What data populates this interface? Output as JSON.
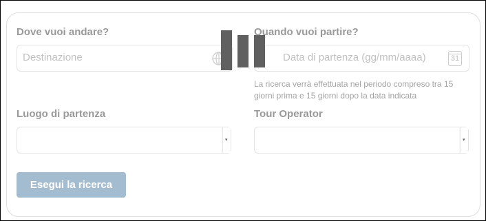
{
  "destination": {
    "label": "Dove vuoi andare?",
    "placeholder": "Destinazione",
    "icon": "globe-icon"
  },
  "departure_date": {
    "label": "Quando vuoi partire?",
    "placeholder": "Data di partenza (gg/mm/aaaa)",
    "icon": "calendar-icon",
    "calendar_day": "31",
    "hint": "La ricerca verrà effettuata nel periodo compreso tra 15 giorni prima e 15 giorni dopo la data indicata"
  },
  "departure_place": {
    "label": "Luogo di partenza",
    "selected": ""
  },
  "tour_operator": {
    "label": "Tour Operator",
    "selected": ""
  },
  "search_button": {
    "label": "Esegui la ricerca",
    "color": "#a4bccf"
  },
  "loading_icon": "loading-bars-icon",
  "colors": {
    "label_text": "#999999",
    "placeholder_text": "#c0c0c0",
    "hint_text": "#a4a4a4",
    "loading_bars": "#606060"
  }
}
